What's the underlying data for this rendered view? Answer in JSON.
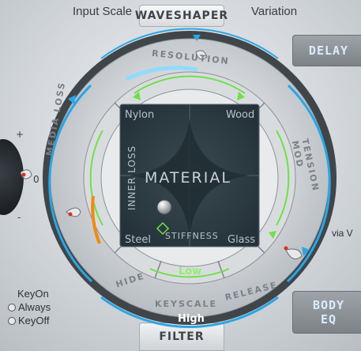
{
  "header": {
    "input_scale_label": "Input Scale",
    "title": "WAVESHAPER",
    "variation_label": "Variation"
  },
  "side_tabs": {
    "delay_label": "DELAY",
    "body_eq_line1": "BODY",
    "body_eq_line2": "EQ",
    "filter_label": "FILTER",
    "via_label": "via V"
  },
  "ring": {
    "top_label": "RESOLUTION",
    "left_label": "MEDIA LOSS",
    "right_label": "TENSION MOD",
    "bottom_segments": [
      "HIDE",
      "KEYSCALE",
      "RELEASE"
    ],
    "low_label": "Low",
    "high_label": "High"
  },
  "pad": {
    "corner_top_left": "Nylon",
    "corner_top_right": "Wood",
    "corner_bottom_left": "Steel",
    "corner_bottom_right": "Glass",
    "center_label": "MATERIAL",
    "y_axis_label": "INNER LOSS",
    "x_axis_label": "STIFFNESS"
  },
  "left_knob": {
    "plus_label": "+",
    "zero_label": "0",
    "minus_label": "-"
  },
  "radio_options": [
    {
      "label": "KeyOn",
      "selected": false
    },
    {
      "label": "Always",
      "selected": false
    },
    {
      "label": "KeyOff",
      "selected": false
    }
  ],
  "colors": {
    "accent_blue": "#2aa6e6",
    "accent_green": "#6fe04a",
    "pad_background": "#2b3a42",
    "indicator_red": "#e03020",
    "indicator_orange": "#f08a10"
  }
}
